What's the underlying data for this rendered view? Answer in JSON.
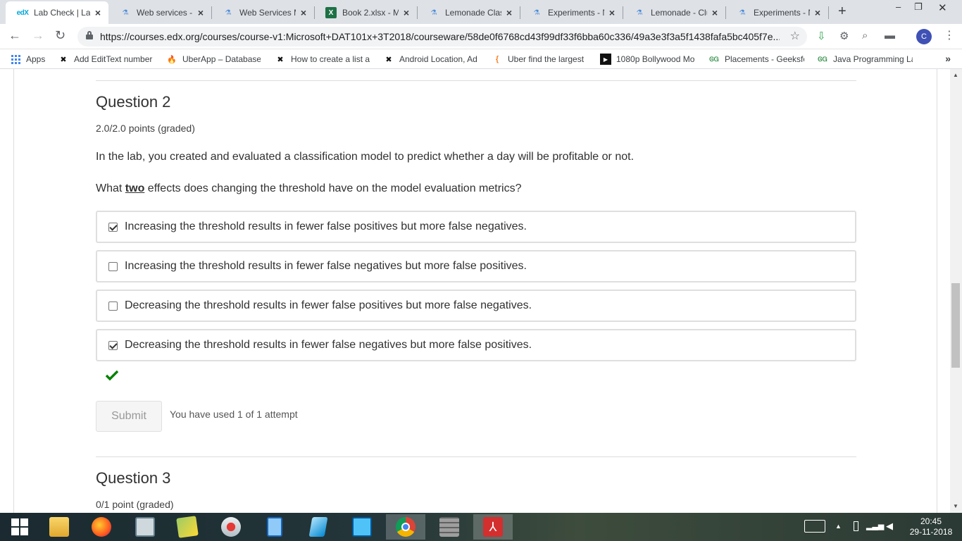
{
  "browser": {
    "tabs": [
      {
        "label": "Lab Check | Lab",
        "icon": "edx-icon",
        "active": true
      },
      {
        "label": "Web services -",
        "icon": "flask-icon"
      },
      {
        "label": "Web Services M",
        "icon": "flask-icon"
      },
      {
        "label": "Book 2.xlsx - M",
        "icon": "excel-icon"
      },
      {
        "label": "Lemonade Clas",
        "icon": "flask-icon"
      },
      {
        "label": "Experiments - N",
        "icon": "flask-icon"
      },
      {
        "label": "Lemonade - Clu",
        "icon": "flask-icon"
      },
      {
        "label": "Experiments - N",
        "icon": "flask-icon"
      }
    ],
    "url": "https://courses.edx.org/courses/course-v1:Microsoft+DAT101x+3T2018/courseware/58de0f6768cd43f99df33f6bba60c336/49a3e3f3a5f1438fafa5bc405f7e...",
    "avatar_letter": "C",
    "bookmarks": [
      {
        "label": "Apps",
        "icon": "apps-icon"
      },
      {
        "label": "Add EditText number",
        "icon": "x-icon"
      },
      {
        "label": "UberApp – Database",
        "icon": "firebase-icon"
      },
      {
        "label": "How to create a list a",
        "icon": "x-icon"
      },
      {
        "label": "Android Location, Ad",
        "icon": "x-icon"
      },
      {
        "label": "Uber find the largest",
        "icon": "curly-icon"
      },
      {
        "label": "1080p Bollywood Mo",
        "icon": "play-icon"
      },
      {
        "label": "Placements - Geeksfo",
        "icon": "gfg-icon"
      },
      {
        "label": "Java Programming La",
        "icon": "gfg-icon"
      }
    ]
  },
  "question2": {
    "title": "Question 2",
    "points": "2.0/2.0 points (graded)",
    "intro": "In the lab, you created and evaluated a classification model to predict whether a day will be profitable or not.",
    "prompt_before": "What ",
    "prompt_emphasis": "two",
    "prompt_after": " effects does changing the threshold have on the model evaluation metrics?",
    "options": [
      {
        "label": "Increasing the threshold results in fewer false positives but more false negatives.",
        "checked": true
      },
      {
        "label": "Increasing the threshold results in fewer false negatives but more false positives.",
        "checked": false
      },
      {
        "label": "Decreasing the threshold results in fewer false positives but more false negatives.",
        "checked": false
      },
      {
        "label": "Decreasing the threshold results in fewer false negatives but more false positives.",
        "checked": true
      }
    ],
    "status": "correct",
    "submit_label": "Submit",
    "attempts_text": "You have used 1 of 1 attempt"
  },
  "question3": {
    "title": "Question 3",
    "points": "0/1 point (graded)"
  },
  "taskbar": {
    "time": "20:45",
    "date": "29-11-2018"
  },
  "colors": {
    "correct": "#008100",
    "option_border": "#dfdfdf",
    "active_tab": "#ffffff",
    "tabstrip": "#dee1e6"
  }
}
